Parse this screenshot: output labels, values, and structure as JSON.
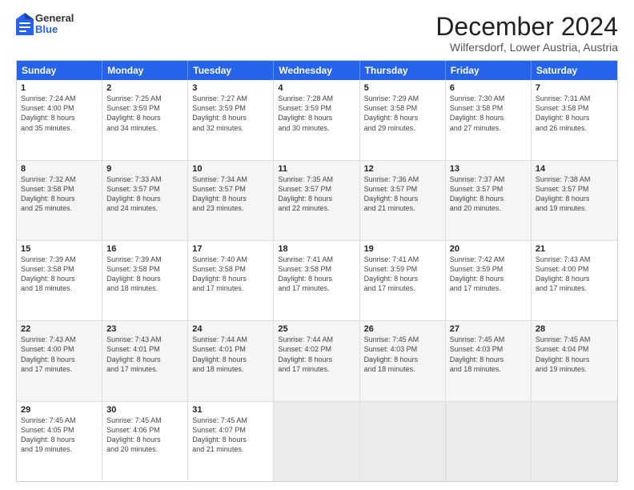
{
  "logo": {
    "general": "General",
    "blue": "Blue"
  },
  "title": "December 2024",
  "subtitle": "Wilfersdorf, Lower Austria, Austria",
  "headers": [
    "Sunday",
    "Monday",
    "Tuesday",
    "Wednesday",
    "Thursday",
    "Friday",
    "Saturday"
  ],
  "weeks": [
    [
      {
        "day": "1",
        "lines": [
          "Sunrise: 7:24 AM",
          "Sunset: 4:00 PM",
          "Daylight: 8 hours",
          "and 35 minutes."
        ]
      },
      {
        "day": "2",
        "lines": [
          "Sunrise: 7:25 AM",
          "Sunset: 3:59 PM",
          "Daylight: 8 hours",
          "and 34 minutes."
        ]
      },
      {
        "day": "3",
        "lines": [
          "Sunrise: 7:27 AM",
          "Sunset: 3:59 PM",
          "Daylight: 8 hours",
          "and 32 minutes."
        ]
      },
      {
        "day": "4",
        "lines": [
          "Sunrise: 7:28 AM",
          "Sunset: 3:59 PM",
          "Daylight: 8 hours",
          "and 30 minutes."
        ]
      },
      {
        "day": "5",
        "lines": [
          "Sunrise: 7:29 AM",
          "Sunset: 3:58 PM",
          "Daylight: 8 hours",
          "and 29 minutes."
        ]
      },
      {
        "day": "6",
        "lines": [
          "Sunrise: 7:30 AM",
          "Sunset: 3:58 PM",
          "Daylight: 8 hours",
          "and 27 minutes."
        ]
      },
      {
        "day": "7",
        "lines": [
          "Sunrise: 7:31 AM",
          "Sunset: 3:58 PM",
          "Daylight: 8 hours",
          "and 26 minutes."
        ]
      }
    ],
    [
      {
        "day": "8",
        "lines": [
          "Sunrise: 7:32 AM",
          "Sunset: 3:58 PM",
          "Daylight: 8 hours",
          "and 25 minutes."
        ]
      },
      {
        "day": "9",
        "lines": [
          "Sunrise: 7:33 AM",
          "Sunset: 3:57 PM",
          "Daylight: 8 hours",
          "and 24 minutes."
        ]
      },
      {
        "day": "10",
        "lines": [
          "Sunrise: 7:34 AM",
          "Sunset: 3:57 PM",
          "Daylight: 8 hours",
          "and 23 minutes."
        ]
      },
      {
        "day": "11",
        "lines": [
          "Sunrise: 7:35 AM",
          "Sunset: 3:57 PM",
          "Daylight: 8 hours",
          "and 22 minutes."
        ]
      },
      {
        "day": "12",
        "lines": [
          "Sunrise: 7:36 AM",
          "Sunset: 3:57 PM",
          "Daylight: 8 hours",
          "and 21 minutes."
        ]
      },
      {
        "day": "13",
        "lines": [
          "Sunrise: 7:37 AM",
          "Sunset: 3:57 PM",
          "Daylight: 8 hours",
          "and 20 minutes."
        ]
      },
      {
        "day": "14",
        "lines": [
          "Sunrise: 7:38 AM",
          "Sunset: 3:57 PM",
          "Daylight: 8 hours",
          "and 19 minutes."
        ]
      }
    ],
    [
      {
        "day": "15",
        "lines": [
          "Sunrise: 7:39 AM",
          "Sunset: 3:58 PM",
          "Daylight: 8 hours",
          "and 18 minutes."
        ]
      },
      {
        "day": "16",
        "lines": [
          "Sunrise: 7:39 AM",
          "Sunset: 3:58 PM",
          "Daylight: 8 hours",
          "and 18 minutes."
        ]
      },
      {
        "day": "17",
        "lines": [
          "Sunrise: 7:40 AM",
          "Sunset: 3:58 PM",
          "Daylight: 8 hours",
          "and 17 minutes."
        ]
      },
      {
        "day": "18",
        "lines": [
          "Sunrise: 7:41 AM",
          "Sunset: 3:58 PM",
          "Daylight: 8 hours",
          "and 17 minutes."
        ]
      },
      {
        "day": "19",
        "lines": [
          "Sunrise: 7:41 AM",
          "Sunset: 3:59 PM",
          "Daylight: 8 hours",
          "and 17 minutes."
        ]
      },
      {
        "day": "20",
        "lines": [
          "Sunrise: 7:42 AM",
          "Sunset: 3:59 PM",
          "Daylight: 8 hours",
          "and 17 minutes."
        ]
      },
      {
        "day": "21",
        "lines": [
          "Sunrise: 7:43 AM",
          "Sunset: 4:00 PM",
          "Daylight: 8 hours",
          "and 17 minutes."
        ]
      }
    ],
    [
      {
        "day": "22",
        "lines": [
          "Sunrise: 7:43 AM",
          "Sunset: 4:00 PM",
          "Daylight: 8 hours",
          "and 17 minutes."
        ]
      },
      {
        "day": "23",
        "lines": [
          "Sunrise: 7:43 AM",
          "Sunset: 4:01 PM",
          "Daylight: 8 hours",
          "and 17 minutes."
        ]
      },
      {
        "day": "24",
        "lines": [
          "Sunrise: 7:44 AM",
          "Sunset: 4:01 PM",
          "Daylight: 8 hours",
          "and 18 minutes."
        ]
      },
      {
        "day": "25",
        "lines": [
          "Sunrise: 7:44 AM",
          "Sunset: 4:02 PM",
          "Daylight: 8 hours",
          "and 17 minutes."
        ]
      },
      {
        "day": "26",
        "lines": [
          "Sunrise: 7:45 AM",
          "Sunset: 4:03 PM",
          "Daylight: 8 hours",
          "and 18 minutes."
        ]
      },
      {
        "day": "27",
        "lines": [
          "Sunrise: 7:45 AM",
          "Sunset: 4:03 PM",
          "Daylight: 8 hours",
          "and 18 minutes."
        ]
      },
      {
        "day": "28",
        "lines": [
          "Sunrise: 7:45 AM",
          "Sunset: 4:04 PM",
          "Daylight: 8 hours",
          "and 19 minutes."
        ]
      }
    ],
    [
      {
        "day": "29",
        "lines": [
          "Sunrise: 7:45 AM",
          "Sunset: 4:05 PM",
          "Daylight: 8 hours",
          "and 19 minutes."
        ]
      },
      {
        "day": "30",
        "lines": [
          "Sunrise: 7:45 AM",
          "Sunset: 4:06 PM",
          "Daylight: 8 hours",
          "and 20 minutes."
        ]
      },
      {
        "day": "31",
        "lines": [
          "Sunrise: 7:45 AM",
          "Sunset: 4:07 PM",
          "Daylight: 8 hours",
          "and 21 minutes."
        ]
      },
      {
        "day": "",
        "lines": []
      },
      {
        "day": "",
        "lines": []
      },
      {
        "day": "",
        "lines": []
      },
      {
        "day": "",
        "lines": []
      }
    ]
  ]
}
